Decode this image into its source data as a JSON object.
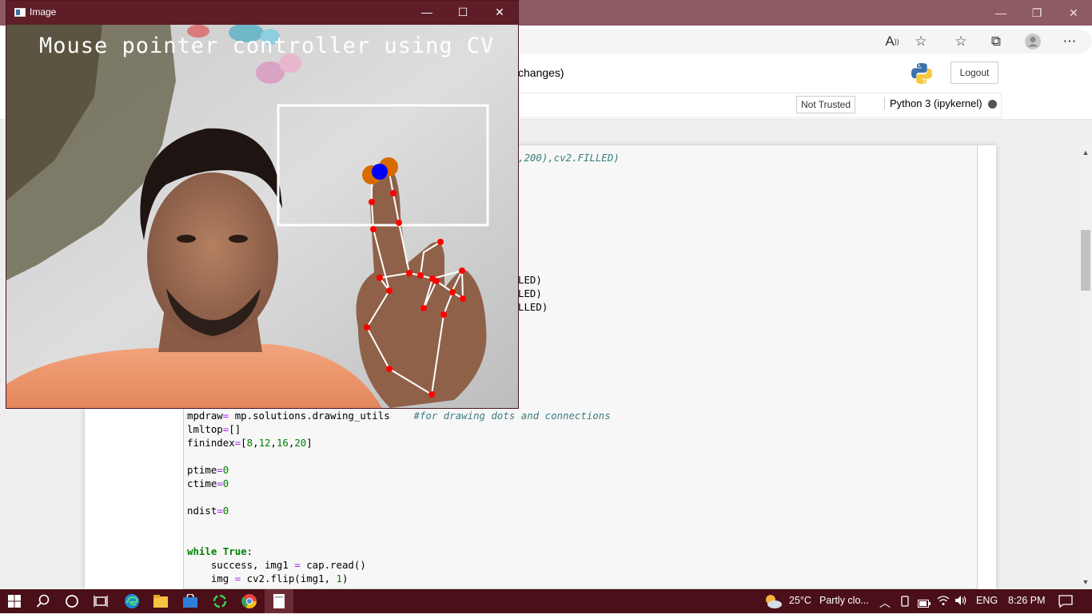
{
  "browser": {
    "minimize_glyph": "—",
    "restore_glyph": "❐",
    "close_glyph": "✕",
    "toolbar_icons": [
      "read-aloud-icon",
      "add-favorite-icon",
      "favorites-icon",
      "collections-icon",
      "profile-icon",
      "more-icon"
    ],
    "read_aloud_glyph": "A",
    "add_favorite_glyph": "☆",
    "favorites_glyph": "☆",
    "collections_glyph": "⧉",
    "more_glyph": "⋯"
  },
  "jupyter": {
    "title_suffix": "changes)",
    "logout_label": "Logout",
    "trust_label": "Not Trusted",
    "kernel_label": "Python 3 (ipykernel)"
  },
  "code": {
    "line_filled_1": ",200),cv2.FILLED)",
    "line_filled_2": "LED)",
    "line_filled_3": "LED)",
    "line_filled_4": "LLED)",
    "mpdraw_var": "mpdraw",
    "mpdraw_op": "=",
    "mpdraw_rhs": " mp.solutions.drawing_utils    ",
    "mpdraw_comment": "#for drawing dots and connections",
    "lmltop_var": "lmltop",
    "lmltop_op": "=",
    "lmltop_rhs": "[]",
    "finindex_var": "finindex",
    "finindex_op": "=",
    "finindex_open": "[",
    "finindex_values": [
      "8",
      "12",
      "16",
      "20"
    ],
    "finindex_close": "]",
    "ptime_var": "ptime",
    "ptime_op": "=",
    "ptime_val": "0",
    "ctime_var": "ctime",
    "ctime_op": "=",
    "ctime_val": "0",
    "ndist_var": "ndist",
    "ndist_op": "=",
    "ndist_val": "0",
    "while_kw": "while",
    "true_kw": " True",
    "while_colon": ":",
    "success_line": "    success, img1 ",
    "success_op": "=",
    "success_rhs": " cap.read()",
    "img_line": "    img ",
    "img_op": "=",
    "img_rhs": " cv2.flip(img1, ",
    "img_num": "1",
    "img_close": ")"
  },
  "image_window": {
    "title": "Image",
    "minimize_glyph": "—",
    "maximize_glyph": "☐",
    "close_glyph": "✕",
    "overlay_text": "Mouse pointer controller using CV"
  },
  "taskbar": {
    "temperature": "25°C",
    "weather": "Partly clo...",
    "language": "ENG",
    "time": "8:26 PM"
  },
  "colors": {
    "hand_landmark": "#ff0000",
    "hand_connection": "#ffffff",
    "fingertip_marker": "#d96a00",
    "cursor_marker": "#0000ff",
    "title_bar": "#5e1d27",
    "taskbar": "#4a0f18"
  }
}
